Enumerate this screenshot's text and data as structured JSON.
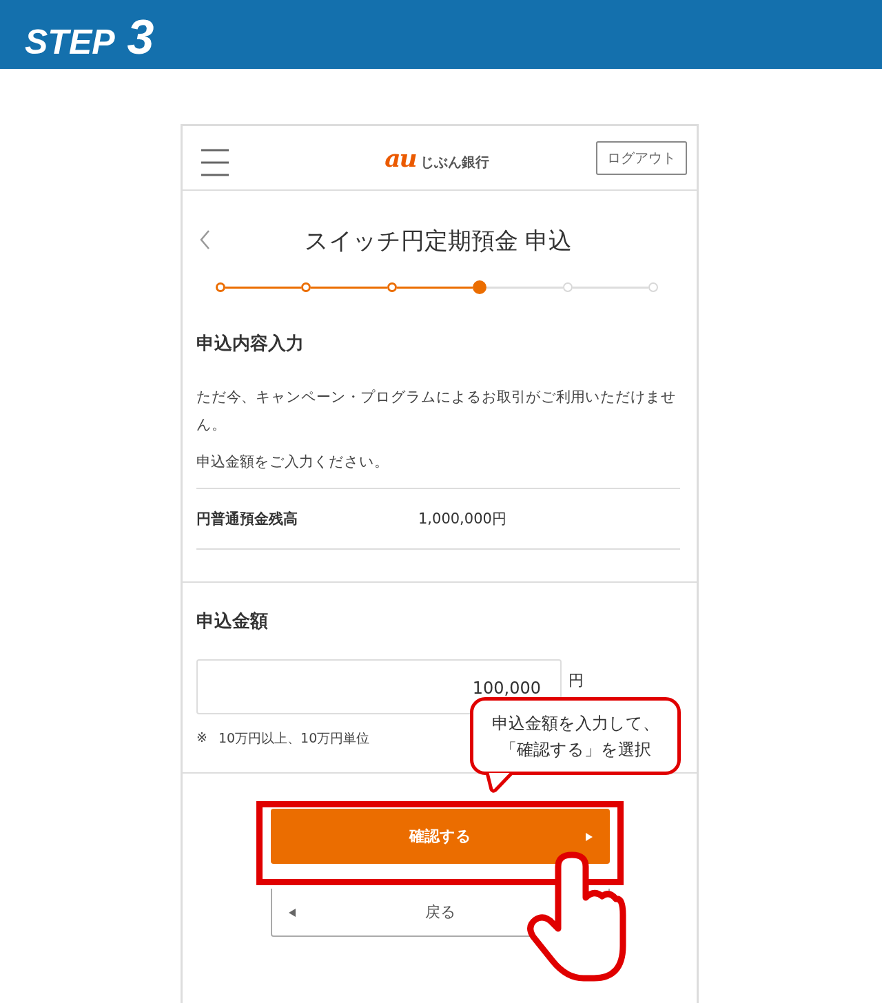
{
  "banner": {
    "step_label": "STEP",
    "step_number": "3"
  },
  "header": {
    "logo_mark": "au",
    "logo_text": "じぶん銀行",
    "logout_button": "ログアウト"
  },
  "page_title": "スイッチ円定期預金 申込",
  "progress_steps": [
    {
      "kind": "done"
    },
    {
      "kind": "done"
    },
    {
      "kind": "done"
    },
    {
      "kind": "current"
    },
    {
      "kind": "todo"
    },
    {
      "kind": "todo"
    }
  ],
  "section_title": "申込内容入力",
  "messages": [
    "ただ今、キャンペーン・プログラムによるお取引がご利用いただけません。",
    "申込金額をご入力ください。"
  ],
  "balance": {
    "label": "円普通預金残高",
    "value": "1,000,000円"
  },
  "amount": {
    "title": "申込金額",
    "value": "100,000",
    "unit": "円",
    "note_mark": "※",
    "note": "10万円以上、10万円単位"
  },
  "confirm_button": "確認する",
  "back_button": "戻る",
  "callout": {
    "lines": [
      "申込金額を入力して、",
      "「確認する」を選択"
    ]
  }
}
